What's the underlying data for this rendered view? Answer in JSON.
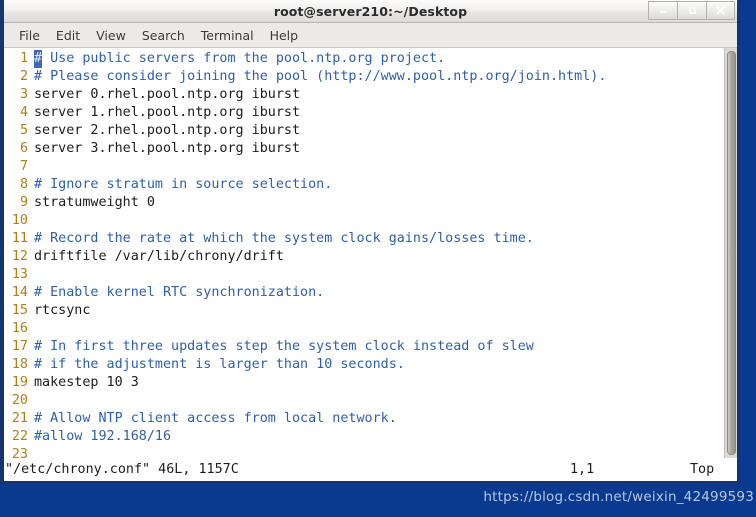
{
  "window": {
    "title": "root@server210:~/Desktop",
    "controls": [
      {
        "name": "minimize-button",
        "glyph": "–"
      },
      {
        "name": "maximize-button",
        "glyph": "□"
      },
      {
        "name": "close-button",
        "glyph": "✕"
      }
    ]
  },
  "menu": {
    "items": [
      {
        "label": "File"
      },
      {
        "label": "Edit"
      },
      {
        "label": "View"
      },
      {
        "label": "Search"
      },
      {
        "label": "Terminal"
      },
      {
        "label": "Help"
      }
    ]
  },
  "editor": {
    "cursor_char": "#",
    "lines": [
      {
        "no": "1",
        "kind": "comment",
        "cursor": true,
        "text": " Use public servers from the pool.ntp.org project."
      },
      {
        "no": "2",
        "kind": "comment",
        "cursor": false,
        "text": "# Please consider joining the pool (http://www.pool.ntp.org/join.html)."
      },
      {
        "no": "3",
        "kind": "code",
        "cursor": false,
        "text": "server 0.rhel.pool.ntp.org iburst"
      },
      {
        "no": "4",
        "kind": "code",
        "cursor": false,
        "text": "server 1.rhel.pool.ntp.org iburst"
      },
      {
        "no": "5",
        "kind": "code",
        "cursor": false,
        "text": "server 2.rhel.pool.ntp.org iburst"
      },
      {
        "no": "6",
        "kind": "code",
        "cursor": false,
        "text": "server 3.rhel.pool.ntp.org iburst"
      },
      {
        "no": "7",
        "kind": "code",
        "cursor": false,
        "text": ""
      },
      {
        "no": "8",
        "kind": "comment",
        "cursor": false,
        "text": "# Ignore stratum in source selection."
      },
      {
        "no": "9",
        "kind": "code",
        "cursor": false,
        "text": "stratumweight 0"
      },
      {
        "no": "10",
        "kind": "code",
        "cursor": false,
        "text": ""
      },
      {
        "no": "11",
        "kind": "comment",
        "cursor": false,
        "text": "# Record the rate at which the system clock gains/losses time."
      },
      {
        "no": "12",
        "kind": "code",
        "cursor": false,
        "text": "driftfile /var/lib/chrony/drift"
      },
      {
        "no": "13",
        "kind": "code",
        "cursor": false,
        "text": ""
      },
      {
        "no": "14",
        "kind": "comment",
        "cursor": false,
        "text": "# Enable kernel RTC synchronization."
      },
      {
        "no": "15",
        "kind": "code",
        "cursor": false,
        "text": "rtcsync"
      },
      {
        "no": "16",
        "kind": "code",
        "cursor": false,
        "text": ""
      },
      {
        "no": "17",
        "kind": "comment",
        "cursor": false,
        "text": "# In first three updates step the system clock instead of slew"
      },
      {
        "no": "18",
        "kind": "comment",
        "cursor": false,
        "text": "# if the adjustment is larger than 10 seconds."
      },
      {
        "no": "19",
        "kind": "code",
        "cursor": false,
        "text": "makestep 10 3"
      },
      {
        "no": "20",
        "kind": "code",
        "cursor": false,
        "text": ""
      },
      {
        "no": "21",
        "kind": "comment",
        "cursor": false,
        "text": "# Allow NTP client access from local network."
      },
      {
        "no": "22",
        "kind": "comment",
        "cursor": false,
        "text": "#allow 192.168/16"
      },
      {
        "no": "23",
        "kind": "code",
        "cursor": false,
        "text": ""
      }
    ]
  },
  "status": {
    "file": "\"/etc/chrony.conf\" 46L, 1157C",
    "position": "1,1",
    "scroll": "Top"
  },
  "watermark": {
    "text": "https://blog.csdn.net/weixin_42499593"
  },
  "colors": {
    "desktop": "#0a3a8f",
    "comment": "#2f5fa8",
    "code": "#1c1c1c",
    "line_number": "#b07d16",
    "cursor": "#3c6ab5",
    "window_border": "#16346e"
  }
}
